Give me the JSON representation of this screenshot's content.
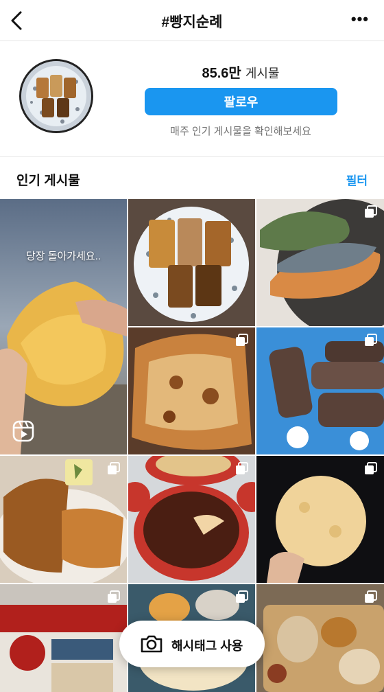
{
  "header": {
    "title": "#빵지순례",
    "back_icon": "chevron-left-icon",
    "more_label": "•••"
  },
  "profile": {
    "post_count": "85.6만",
    "post_count_label": "게시물",
    "follow_label": "팔로우",
    "weekly_text": "매주 인기 게시물을 확인해보세요"
  },
  "section": {
    "title": "인기 게시물",
    "filter_label": "필터"
  },
  "posts": [
    {
      "overlay": "당장 돌아가세요..",
      "type": "reel"
    },
    {
      "type": "single"
    },
    {
      "type": "multi"
    },
    {
      "type": "multi"
    },
    {
      "type": "multi"
    },
    {
      "type": "multi"
    },
    {
      "type": "multi"
    },
    {
      "type": "multi"
    },
    {
      "type": "multi"
    },
    {
      "type": "multi"
    },
    {
      "type": "multi"
    }
  ],
  "fab": {
    "label": "해시태그 사용",
    "icon": "camera-icon"
  },
  "colors": {
    "accent": "#1a96f0",
    "secondary_text": "#737373"
  }
}
